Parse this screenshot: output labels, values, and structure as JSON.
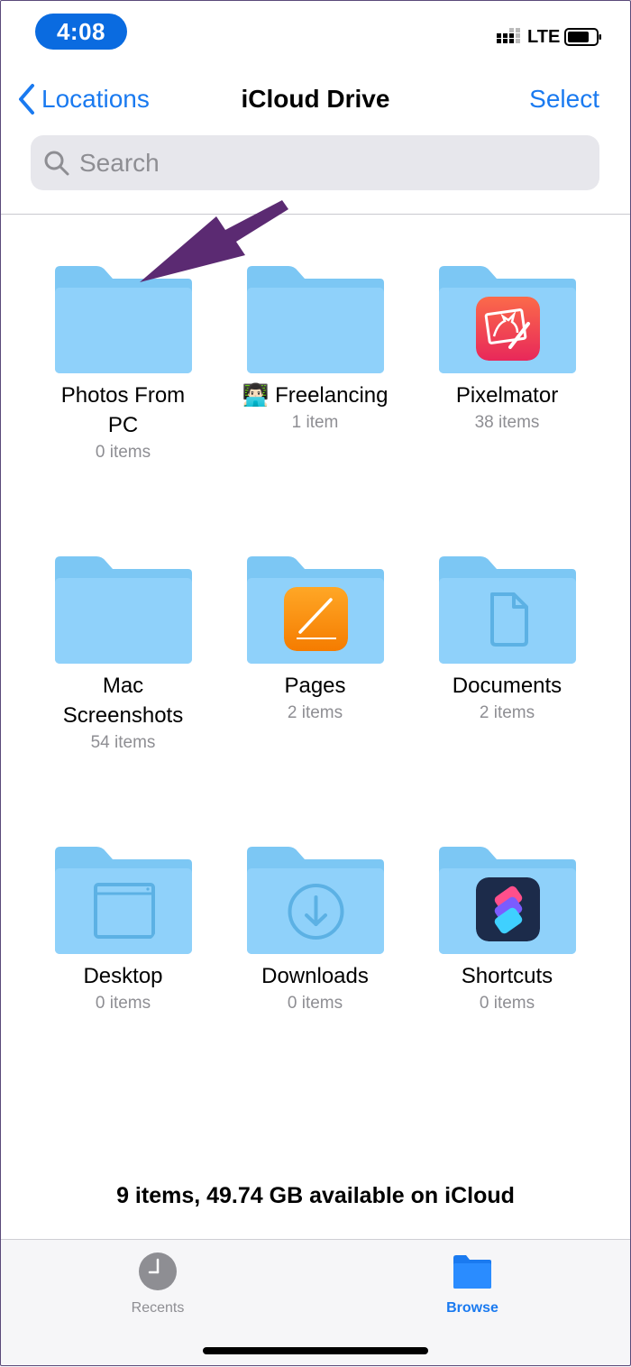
{
  "status_bar": {
    "time": "4:08",
    "carrier": "LTE"
  },
  "nav": {
    "back_label": "Locations",
    "title": "iCloud Drive",
    "select_label": "Select"
  },
  "search": {
    "placeholder": "Search"
  },
  "folders": [
    {
      "name": "Photos From PC",
      "count": "0 items",
      "icon": "folder-icon"
    },
    {
      "name": "👨🏻‍💻 Freelancing",
      "count": "1 item",
      "icon": "folder-icon"
    },
    {
      "name": "Pixelmator",
      "count": "38 items",
      "icon": "pixelmator-app-icon"
    },
    {
      "name": "Mac Screenshots",
      "count": "54 items",
      "icon": "folder-icon"
    },
    {
      "name": "Pages",
      "count": "2 items",
      "icon": "pages-app-icon"
    },
    {
      "name": "Documents",
      "count": "2 items",
      "icon": "document-icon"
    },
    {
      "name": "Desktop",
      "count": "0 items",
      "icon": "desktop-window-icon"
    },
    {
      "name": "Downloads",
      "count": "0 items",
      "icon": "download-arrow-icon"
    },
    {
      "name": "Shortcuts",
      "count": "0 items",
      "icon": "shortcuts-app-icon"
    }
  ],
  "footer": {
    "storage_text": "9 items, 49.74 GB available on iCloud"
  },
  "tabbar": {
    "tabs": [
      {
        "label": "Recents",
        "icon": "clock-icon",
        "active": false
      },
      {
        "label": "Browse",
        "icon": "folder-icon",
        "active": true
      }
    ]
  },
  "colors": {
    "accent": "#1a7af0",
    "folder": "#8fd1fa",
    "folder_tab": "#7cc7f4",
    "annotation_arrow": "#5b2a72"
  }
}
